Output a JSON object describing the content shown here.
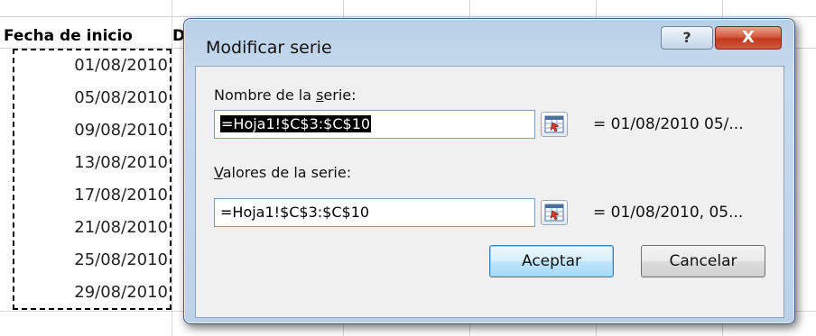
{
  "spreadsheet": {
    "column_header": "Fecha de inicio",
    "next_column_header_fragment": "D",
    "dates": [
      "01/08/2010",
      "05/08/2010",
      "09/08/2010",
      "13/08/2010",
      "17/08/2010",
      "21/08/2010",
      "25/08/2010",
      "29/08/2010"
    ]
  },
  "dialog": {
    "title": "Modificar serie",
    "help_glyph": "?",
    "close_glyph": "X",
    "series_name": {
      "label_before": "Nombre de la ",
      "label_access": "s",
      "label_after": "erie:",
      "value": "=Hoja1!$C$3:$C$10",
      "preview": "= 01/08/2010 05/..."
    },
    "series_values": {
      "label_access": "V",
      "label_after": "alores de la serie:",
      "value": "=Hoja1!$C$3:$C$10",
      "preview": "= 01/08/2010, 05..."
    },
    "ok_label": "Aceptar",
    "cancel_label": "Cancelar"
  },
  "icons": {
    "collapse": "range-collapse-icon"
  },
  "colors": {
    "frame": "#bcd2e8",
    "close": "#c1391c",
    "default_button": "#bee6fd"
  }
}
